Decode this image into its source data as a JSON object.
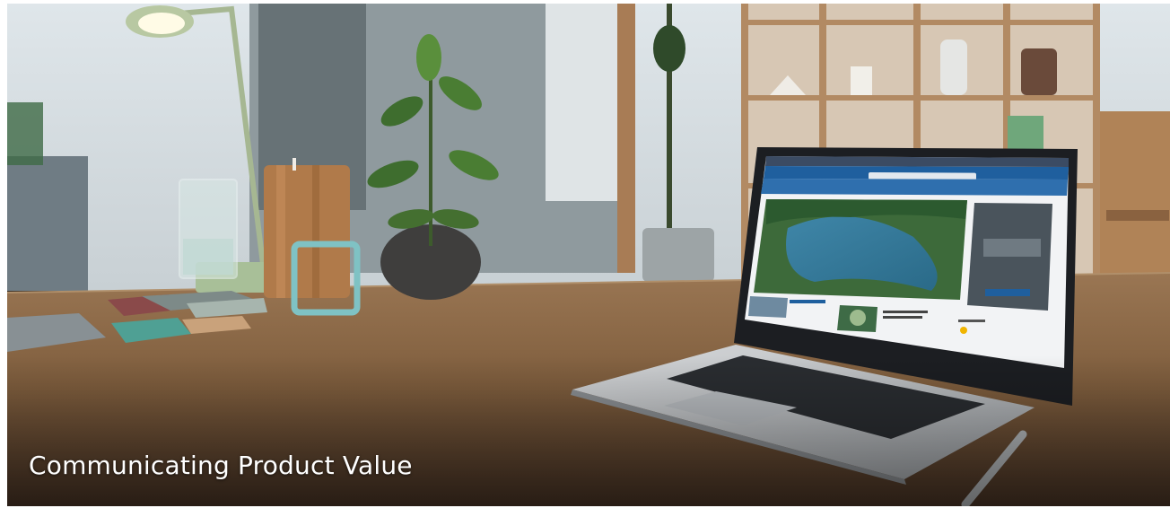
{
  "hero": {
    "caption": "Communicating Product Value"
  },
  "colors": {
    "wall": "#e9eef1",
    "table_wood": "#8a6a48",
    "laptop_silver": "#c9cccf",
    "screen_header_blue": "#1f5f9e",
    "caption_text": "#ffffff"
  },
  "scene": {
    "items": [
      "desk-lamp",
      "water-glass",
      "wooden-cup",
      "potted-plant",
      "photo-frame",
      "tile-swatches",
      "bookshelf",
      "laptop",
      "stylus-pen"
    ]
  }
}
